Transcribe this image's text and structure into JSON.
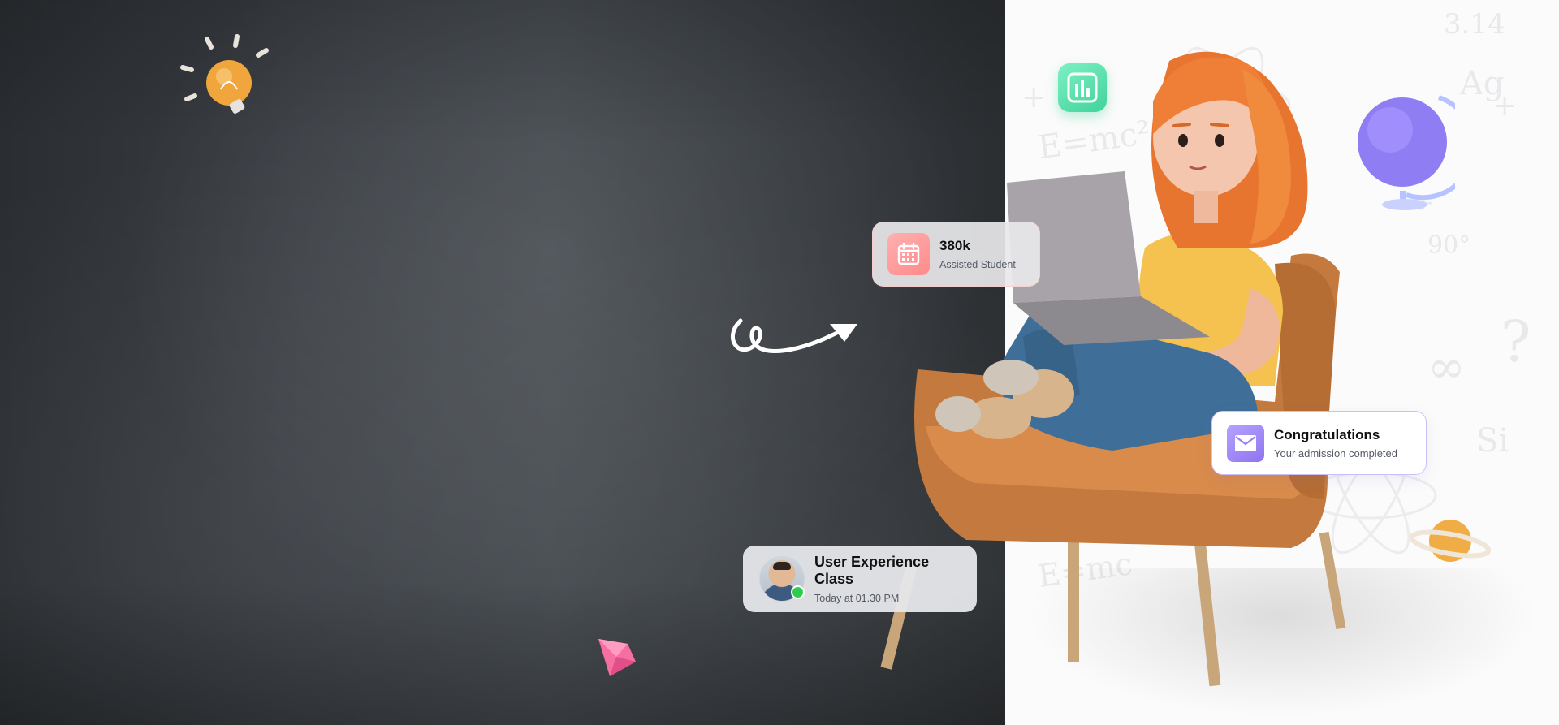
{
  "stats_card": {
    "value": "380k",
    "label": "Assisted Student",
    "icon": "calendar-icon"
  },
  "admission_card": {
    "title": "Congratulations",
    "message": "Your admission completed",
    "icon": "mail-icon"
  },
  "class_card": {
    "title": "User Experience Class",
    "time": "Today at 01.30 PM",
    "status": "online"
  },
  "decorations": {
    "bulb": "lightbulb-icon",
    "gem": "gem-icon",
    "chart": "bar-chart-icon",
    "globe": "globe-icon",
    "planet": "planet-icon",
    "arrow": "swirl-arrow-icon"
  },
  "colors": {
    "board": "#3a3e43",
    "stats_icon_bg": "#ff8a8a",
    "admission_icon_bg": "#8f74f0",
    "chart_tile": "#3fd39a",
    "online": "#2ecc4a"
  }
}
